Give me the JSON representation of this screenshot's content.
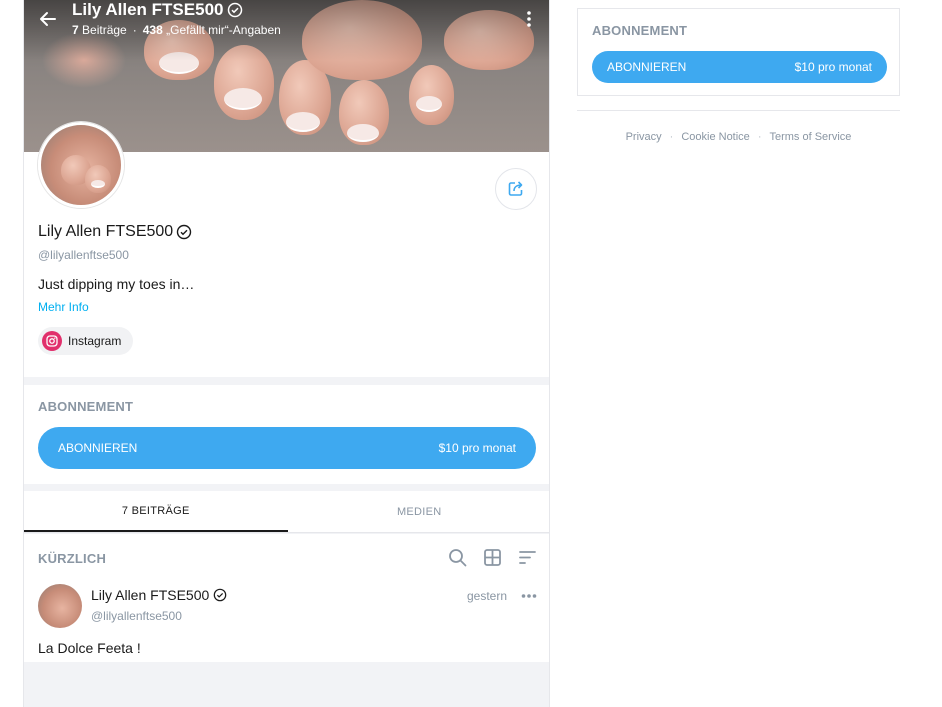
{
  "header": {
    "title": "Lily Allen FTSE500",
    "posts_count": "7",
    "posts_label": "Beiträge",
    "likes_count": "438",
    "likes_label": "„Gefällt mir“-Angaben"
  },
  "profile": {
    "name": "Lily Allen FTSE500",
    "handle": "@lilyallenftse500",
    "bio": "Just dipping my toes in…",
    "more_info": "Mehr Info",
    "instagram_label": "Instagram"
  },
  "subscription": {
    "title": "ABONNEMENT",
    "button_label": "ABONNIEREN",
    "price": "$10 pro monat"
  },
  "tabs": [
    {
      "label": "7 BEITRÄGE",
      "active": true
    },
    {
      "label": "MEDIEN",
      "active": false
    }
  ],
  "feed": {
    "heading": "KÜRZLICH",
    "post": {
      "name": "Lily Allen FTSE500",
      "handle": "@lilyallenftse500",
      "time": "gestern",
      "text": "La Dolce Feeta !"
    }
  },
  "sidebar": {
    "title": "ABONNEMENT",
    "button_label": "ABONNIEREN",
    "price": "$10 pro monat"
  },
  "footer": {
    "links": [
      "Privacy",
      "Cookie Notice",
      "Terms of Service"
    ]
  },
  "colors": {
    "accent": "#3ea9f0",
    "link": "#00aff0",
    "muted": "#8a96a3",
    "instagram": "#e1306c"
  },
  "icons": [
    "back-arrow-icon",
    "verified-icon",
    "more-vertical-icon",
    "share-icon",
    "instagram-icon",
    "search-icon",
    "grid-icon",
    "sort-icon",
    "more-horizontal-icon"
  ]
}
